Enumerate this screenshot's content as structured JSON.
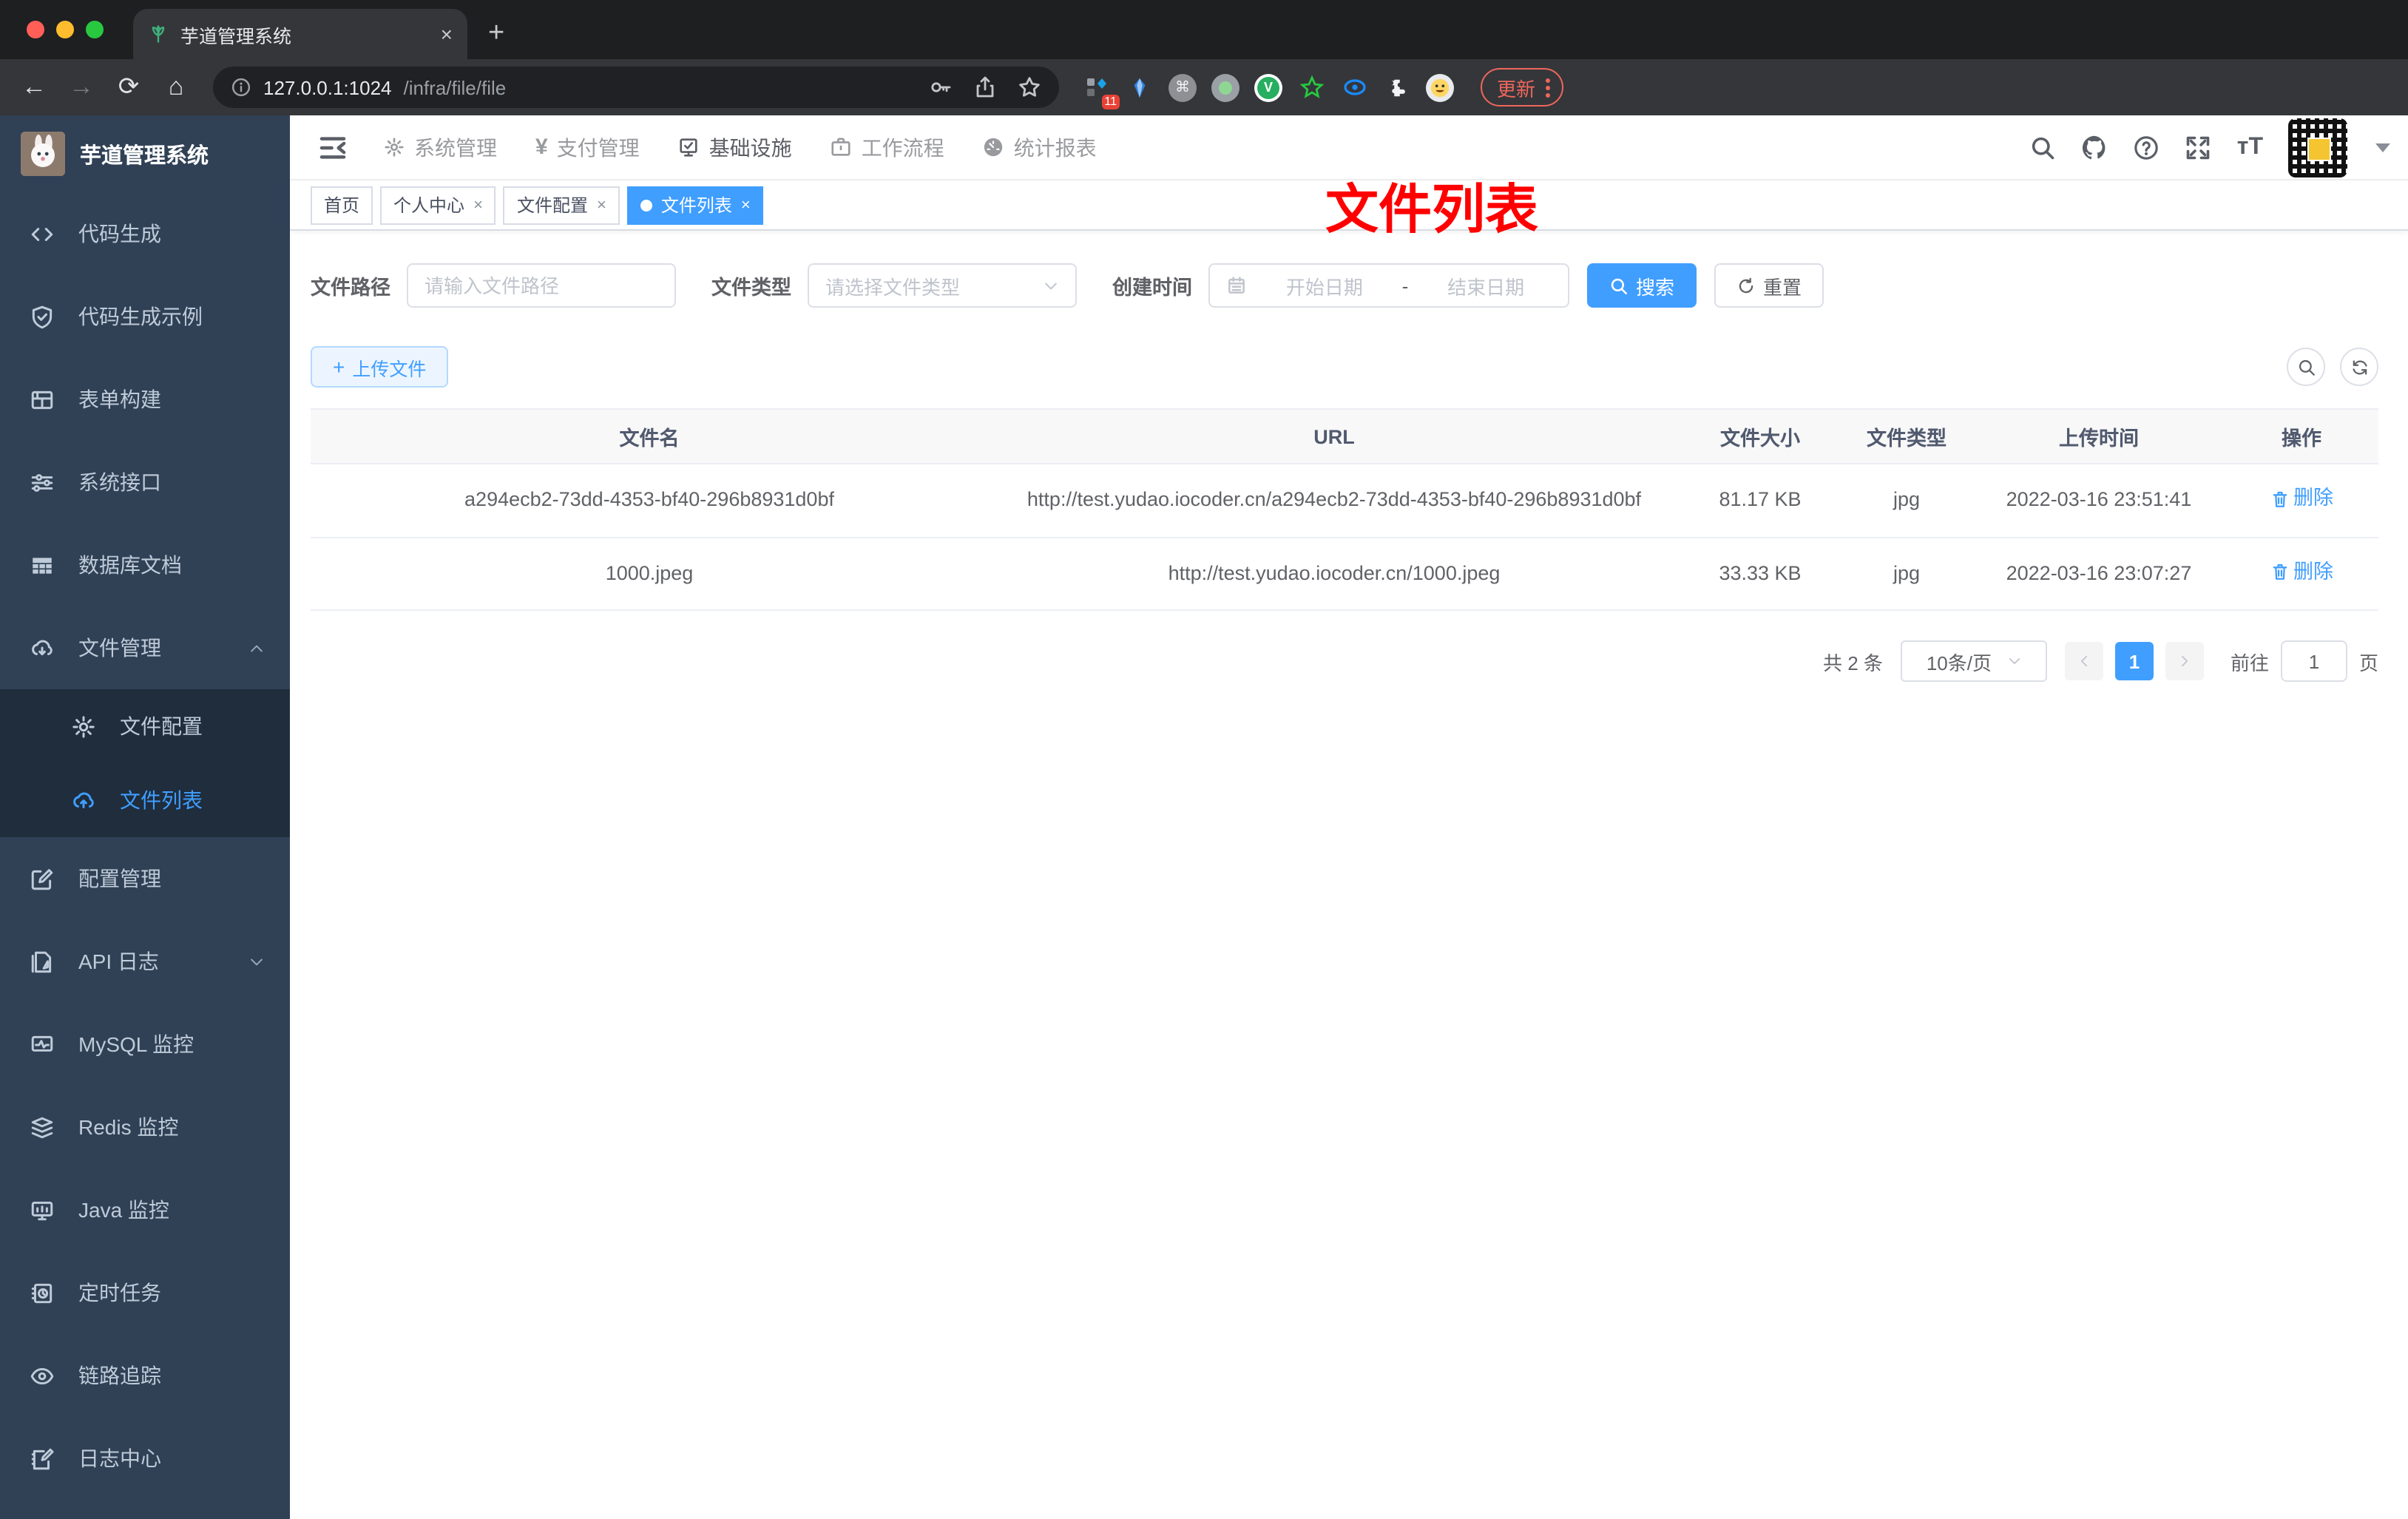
{
  "browser": {
    "tab_title": "芋道管理系统",
    "url_host": "127.0.0.1:1024",
    "url_path": "/infra/file/file",
    "extensions_badge": "11",
    "update_label": "更新"
  },
  "glyphs": {
    "close": "×",
    "plus": "+",
    "command": "⌘"
  },
  "sidebar": {
    "title": "芋道管理系统",
    "items": [
      {
        "label": "代码生成"
      },
      {
        "label": "代码生成示例"
      },
      {
        "label": "表单构建"
      },
      {
        "label": "系统接口"
      },
      {
        "label": "数据库文档"
      },
      {
        "label": "文件管理"
      },
      {
        "label": "文件配置"
      },
      {
        "label": "文件列表"
      },
      {
        "label": "配置管理"
      },
      {
        "label": "API 日志"
      },
      {
        "label": "MySQL 监控"
      },
      {
        "label": "Redis 监控"
      },
      {
        "label": "Java 监控"
      },
      {
        "label": "定时任务"
      },
      {
        "label": "链路追踪"
      },
      {
        "label": "日志中心"
      }
    ]
  },
  "topnav": {
    "items": [
      {
        "label": "系统管理"
      },
      {
        "label": "支付管理"
      },
      {
        "label": "基础设施"
      },
      {
        "label": "工作流程"
      },
      {
        "label": "统计报表"
      }
    ]
  },
  "tags": {
    "items": [
      {
        "label": "首页"
      },
      {
        "label": "个人中心"
      },
      {
        "label": "文件配置"
      },
      {
        "label": "文件列表"
      }
    ]
  },
  "annotation": {
    "text": "文件列表",
    "color": "#ff0000"
  },
  "filter": {
    "path_label": "文件路径",
    "path_placeholder": "请输入文件路径",
    "type_label": "文件类型",
    "type_placeholder": "请选择文件类型",
    "date_label": "创建时间",
    "date_start_placeholder": "开始日期",
    "date_separator": "-",
    "date_end_placeholder": "结束日期",
    "search_label": "搜索",
    "reset_label": "重置"
  },
  "toolbar": {
    "upload_label": "上传文件"
  },
  "table": {
    "columns": [
      "文件名",
      "URL",
      "文件大小",
      "文件类型",
      "上传时间",
      "操作"
    ],
    "rows": [
      {
        "name": "a294ecb2-73dd-4353-bf40-296b8931d0bf",
        "url": "http://test.yudao.iocoder.cn/a294ecb2-73dd-4353-bf40-296b8931d0bf",
        "size": "81.17 KB",
        "type": "jpg",
        "time": "2022-03-16 23:51:41",
        "action": "删除"
      },
      {
        "name": "1000.jpeg",
        "url": "http://test.yudao.iocoder.cn/1000.jpeg",
        "size": "33.33 KB",
        "type": "jpg",
        "time": "2022-03-16 23:07:27",
        "action": "删除"
      }
    ]
  },
  "pagination": {
    "total": "共 2 条",
    "page_size": "10条/页",
    "current_page": "1",
    "goto_label": "前往",
    "goto_value": "1",
    "page_unit": "页"
  }
}
